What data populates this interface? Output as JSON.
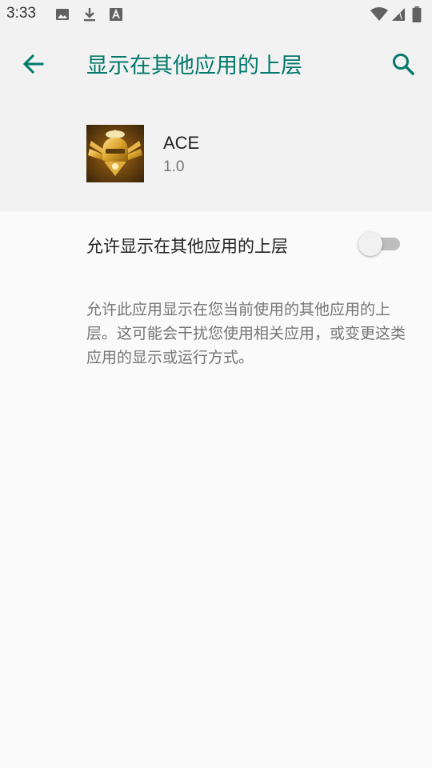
{
  "status_bar": {
    "time": "3:33",
    "icons": [
      "image-icon",
      "download-icon",
      "font-icon",
      "wifi-icon",
      "signal-icon",
      "battery-icon"
    ]
  },
  "app_bar": {
    "title": "显示在其他应用的上层",
    "back_icon": "arrow-back-icon",
    "search_icon": "search-icon"
  },
  "app": {
    "name": "ACE",
    "version": "1.0",
    "icon": "ace-app-icon"
  },
  "permission": {
    "label": "允许显示在其他应用的上层",
    "enabled": false
  },
  "description": "允许此应用显示在您当前使用的其他应用的上层。这可能会干扰您使用相关应用，或变更这类应用的显示或运行方式。",
  "colors": {
    "accent": "#00796b",
    "header_bg": "#f2f2f2",
    "page_bg": "#fafafa"
  }
}
